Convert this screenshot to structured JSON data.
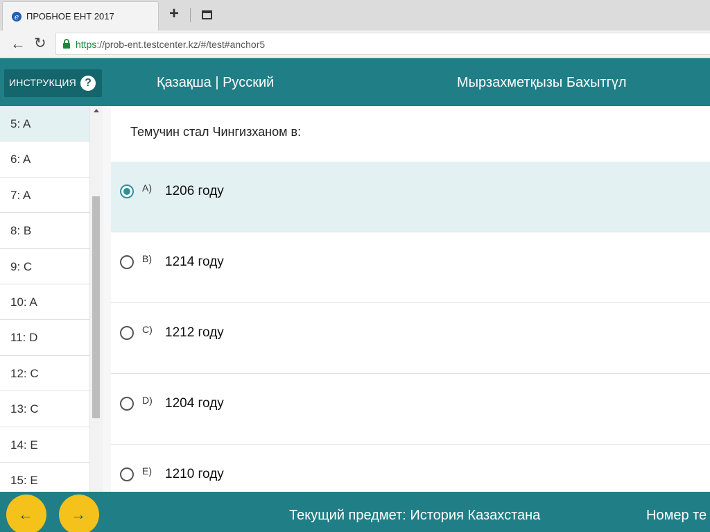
{
  "browser": {
    "tab_title": "ПРОБНОЕ ЕНТ 2017",
    "url_scheme": "https",
    "url_rest": "://prob-ent.testcenter.kz/#/test#anchor5"
  },
  "header": {
    "instruction_label": "ИНСТРУКЦИЯ",
    "lang_kazakh": "Қазақша",
    "lang_separator": "|",
    "lang_russian": "Русский",
    "user_name": "Мырзахметқызы Бахытгүл"
  },
  "sidebar": {
    "items": [
      {
        "label": "5: A"
      },
      {
        "label": "6: A"
      },
      {
        "label": "7: A"
      },
      {
        "label": "8: B"
      },
      {
        "label": "9: C"
      },
      {
        "label": "10: A"
      },
      {
        "label": "11: D"
      },
      {
        "label": "12: C"
      },
      {
        "label": "13: C"
      },
      {
        "label": "14: E"
      },
      {
        "label": "15: E"
      }
    ]
  },
  "question": {
    "text": "Темучин стал Чингизханом в:",
    "options": [
      {
        "letter": "A)",
        "text": "1206 году",
        "selected": true
      },
      {
        "letter": "B)",
        "text": "1214 году",
        "selected": false
      },
      {
        "letter": "C)",
        "text": "1212 году",
        "selected": false
      },
      {
        "letter": "D)",
        "text": "1204 году",
        "selected": false
      },
      {
        "letter": "E)",
        "text": "1210 году",
        "selected": false
      }
    ]
  },
  "footer": {
    "current_subject": "Текущий предмет: История Казахстана",
    "question_number_label": "Номер те"
  },
  "colors": {
    "header_bg": "#1f7e86",
    "accent_yellow": "#f4c21a",
    "selected_bg": "#e3f1f2"
  }
}
